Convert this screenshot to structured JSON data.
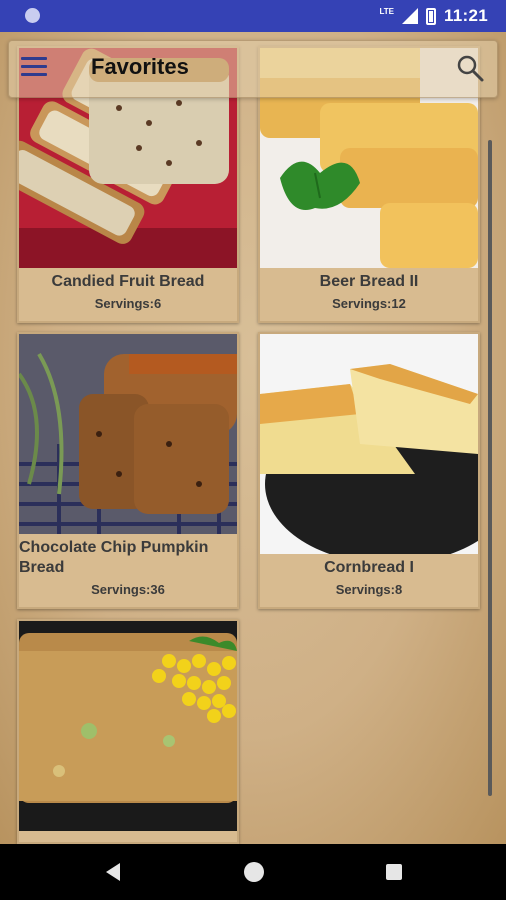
{
  "status_bar": {
    "network": "LTE",
    "time": "11:21"
  },
  "toolbar": {
    "title": "Favorites",
    "menu_icon": "menu-icon",
    "search_icon": "search-icon"
  },
  "recipes": [
    {
      "title": "Candied Fruit Bread",
      "servings": "Servings:6"
    },
    {
      "title": "Beer Bread II",
      "servings": "Servings:12"
    },
    {
      "title": "Chocolate Chip Pumpkin Bread",
      "servings": "Servings:36"
    },
    {
      "title": "Cornbread I",
      "servings": "Servings:8"
    },
    {
      "title": "",
      "servings": ""
    }
  ],
  "nav_bar": {
    "back": "back-icon",
    "home": "home-icon",
    "recents": "recents-icon"
  }
}
